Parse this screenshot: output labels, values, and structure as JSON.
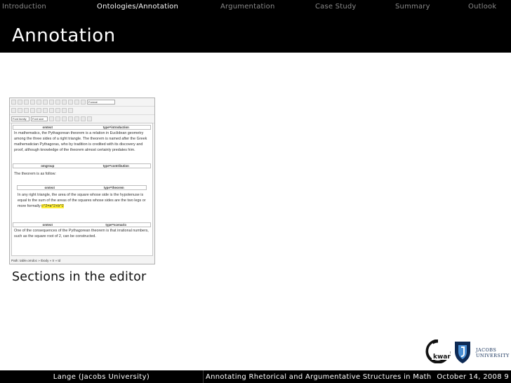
{
  "nav": {
    "items": [
      {
        "label": "Introduction",
        "active": false
      },
      {
        "label": "Ontologies/Annotation",
        "active": true
      },
      {
        "label": "Argumentation",
        "active": false
      },
      {
        "label": "Case Study",
        "active": false
      },
      {
        "label": "Summary",
        "active": false
      },
      {
        "label": "Outlook",
        "active": false
      }
    ]
  },
  "slide": {
    "title": "Annotation",
    "caption": "Sections in the editor"
  },
  "editor": {
    "toolbar": {
      "format_select": "Format",
      "font_family_select": "Font family",
      "font_size_select": "Font size"
    },
    "sections": [
      {
        "header_left": "omtext",
        "header_right": "type=introduction",
        "text": "In mathematics, the Pythagorean theorem is a relation in Euclidean geometry among the three sides of a right triangle. The theorem is named after the Greek mathematician Pythagoras, who by tradition is credited with its discovery and proof, although knowledge of the theorem almost certainly predates him."
      },
      {
        "header_left": "omgroup",
        "header_right": "type=contribution",
        "text": "The theorem is as follow:"
      },
      {
        "header_left": "omtext",
        "header_right": "type=theorem",
        "text": "In any right triangle, the area of the square whose side is the hypotenuse is equal to the sum of the areas of the squares whose sides are the two legs or more formally",
        "formula": "c^2=a^2+b^2"
      },
      {
        "header_left": "omtext",
        "header_right": "type=scenario",
        "text": "One of the consequences of the Pythagorean theorem is that irrational numbers, such as the square root of 2, can be constructed."
      }
    ],
    "status_path": "Path: table.omdoc » tbody » tr » td"
  },
  "logos": {
    "kwarc": "kwarc",
    "jacobs_line1": "JACOBS",
    "jacobs_line2": "UNIVERSITY"
  },
  "footer": {
    "author": "Lange  (Jacobs University)",
    "talk_title": "Annotating Rhetorical and Argumentative Structures in Math",
    "date_page": "October 14, 2008  9"
  },
  "colors": {
    "bar_background": "#000000",
    "nav_inactive": "#8a8a8a",
    "nav_active": "#ffffff",
    "formula_highlight": "#ffee33",
    "jacobs_blue": "#0d2a55"
  }
}
